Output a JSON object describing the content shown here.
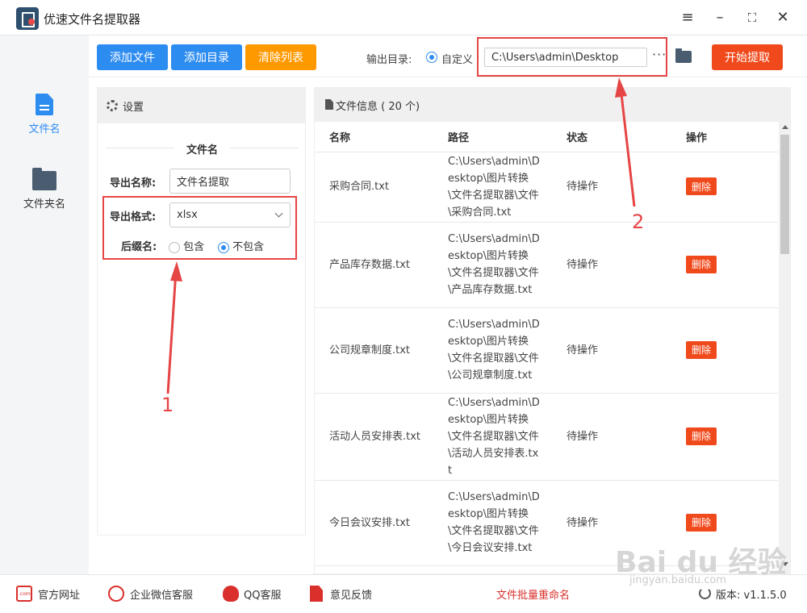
{
  "app": {
    "title": "优速文件名提取器"
  },
  "sidebar": {
    "items": [
      {
        "label": "文件名",
        "active": true
      },
      {
        "label": "文件夹名",
        "active": false
      }
    ]
  },
  "toolbar": {
    "add_file": "添加文件",
    "add_dir": "添加目录",
    "clear_list": "清除列表",
    "output_dir_label": "输出目录:",
    "custom_label": "自定义",
    "output_path": "C:\\Users\\admin\\Desktop",
    "more": "···",
    "start": "开始提取"
  },
  "settings": {
    "header": "设置",
    "section_title": "文件名",
    "export_name_label": "导出名称:",
    "export_name_value": "文件名提取",
    "export_format_label": "导出格式:",
    "export_format_value": "xlsx",
    "suffix_label": "后缀名:",
    "suffix_options": [
      "包含",
      "不包含"
    ],
    "suffix_selected": "不包含"
  },
  "files": {
    "header": "文件信息 ( 20 个)",
    "columns": [
      "名称",
      "路径",
      "状态",
      "操作"
    ],
    "rows": [
      {
        "name": "采购合同.txt",
        "path": "C:\\Users\\admin\\Desktop\\图片转换\\文件名提取器\\文件\\采购合同.txt",
        "status": "待操作",
        "action": "删除"
      },
      {
        "name": "产品库存数据.txt",
        "path": "C:\\Users\\admin\\Desktop\\图片转换\\文件名提取器\\文件\\产品库存数据.txt",
        "status": "待操作",
        "action": "删除"
      },
      {
        "name": "公司规章制度.txt",
        "path": "C:\\Users\\admin\\Desktop\\图片转换\\文件名提取器\\文件\\公司规章制度.txt",
        "status": "待操作",
        "action": "删除"
      },
      {
        "name": "活动人员安排表.txt",
        "path": "C:\\Users\\admin\\Desktop\\图片转换\\文件名提取器\\文件\\活动人员安排表.txt",
        "status": "待操作",
        "action": "删除"
      },
      {
        "name": "今日会议安排.txt",
        "path": "C:\\Users\\admin\\Desktop\\图片转换\\文件名提取器\\文件\\今日会议安排.txt",
        "status": "待操作",
        "action": "删除"
      }
    ]
  },
  "footer": {
    "website": "官方网址",
    "wechat": "企业微信客服",
    "qq": "QQ客服",
    "feedback": "意见反馈",
    "promo": "文件批量重命名",
    "version_label": "版本:",
    "version": "v1.1.5.0"
  },
  "annotations": {
    "one": "1",
    "two": "2"
  },
  "watermark": {
    "main": "Bai du 经验",
    "sub": "jingyan.baidu.com"
  },
  "colors": {
    "primary": "#2d8cf0",
    "warning": "#ff9900",
    "danger": "#f04a1c",
    "annotation": "#e64545"
  }
}
